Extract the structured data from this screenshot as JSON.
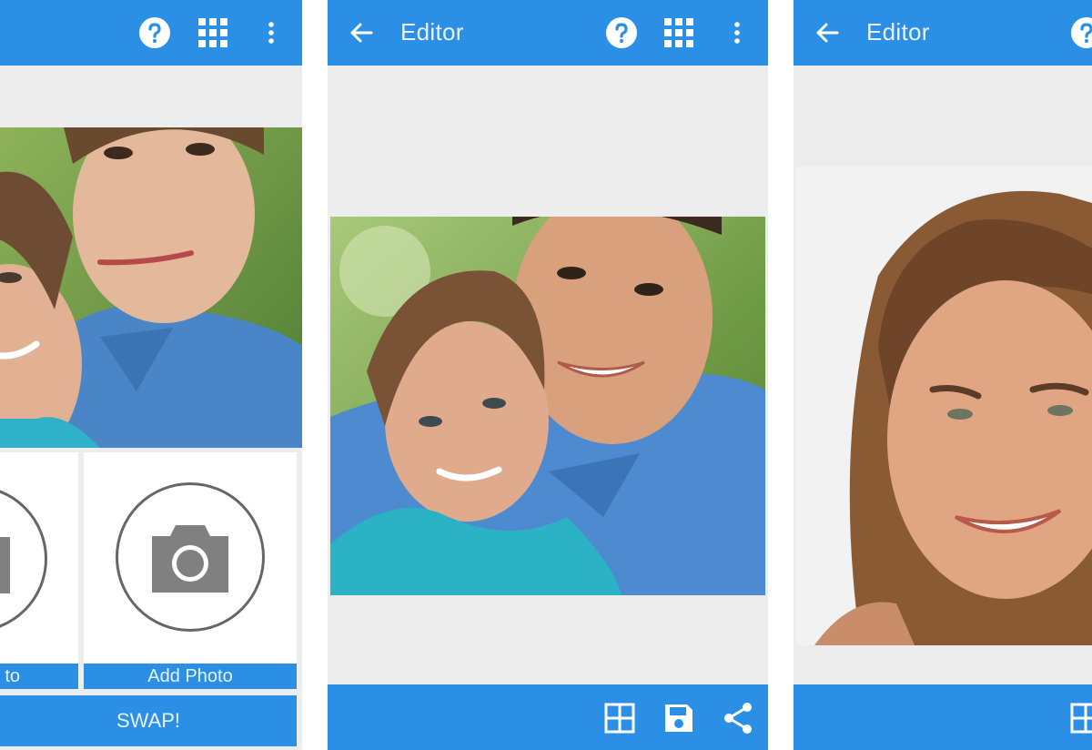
{
  "screens": [
    {
      "toolbar": {
        "icons": [
          "help-icon",
          "grid-apps-icon",
          "more-vert-icon"
        ]
      },
      "slots": [
        {
          "label": "Add Photo",
          "visible_label": "to",
          "icon": "camera-icon"
        },
        {
          "label": "Add Photo",
          "icon": "camera-icon"
        }
      ],
      "swap_button": {
        "label": "SWAP!"
      }
    },
    {
      "toolbar": {
        "title": "Editor",
        "icons": [
          "back-arrow-icon",
          "help-icon",
          "grid-apps-icon",
          "more-vert-icon"
        ]
      },
      "bottom_actions": [
        "collage-icon",
        "save-icon",
        "share-icon"
      ]
    },
    {
      "toolbar": {
        "title": "Editor",
        "icons": [
          "back-arrow-icon",
          "help-icon"
        ]
      },
      "bottom_actions": [
        "collage-icon"
      ]
    }
  ],
  "colors": {
    "primary": "#2b8fe5",
    "background": "#ededed",
    "on_primary": "#e9f3fd"
  }
}
